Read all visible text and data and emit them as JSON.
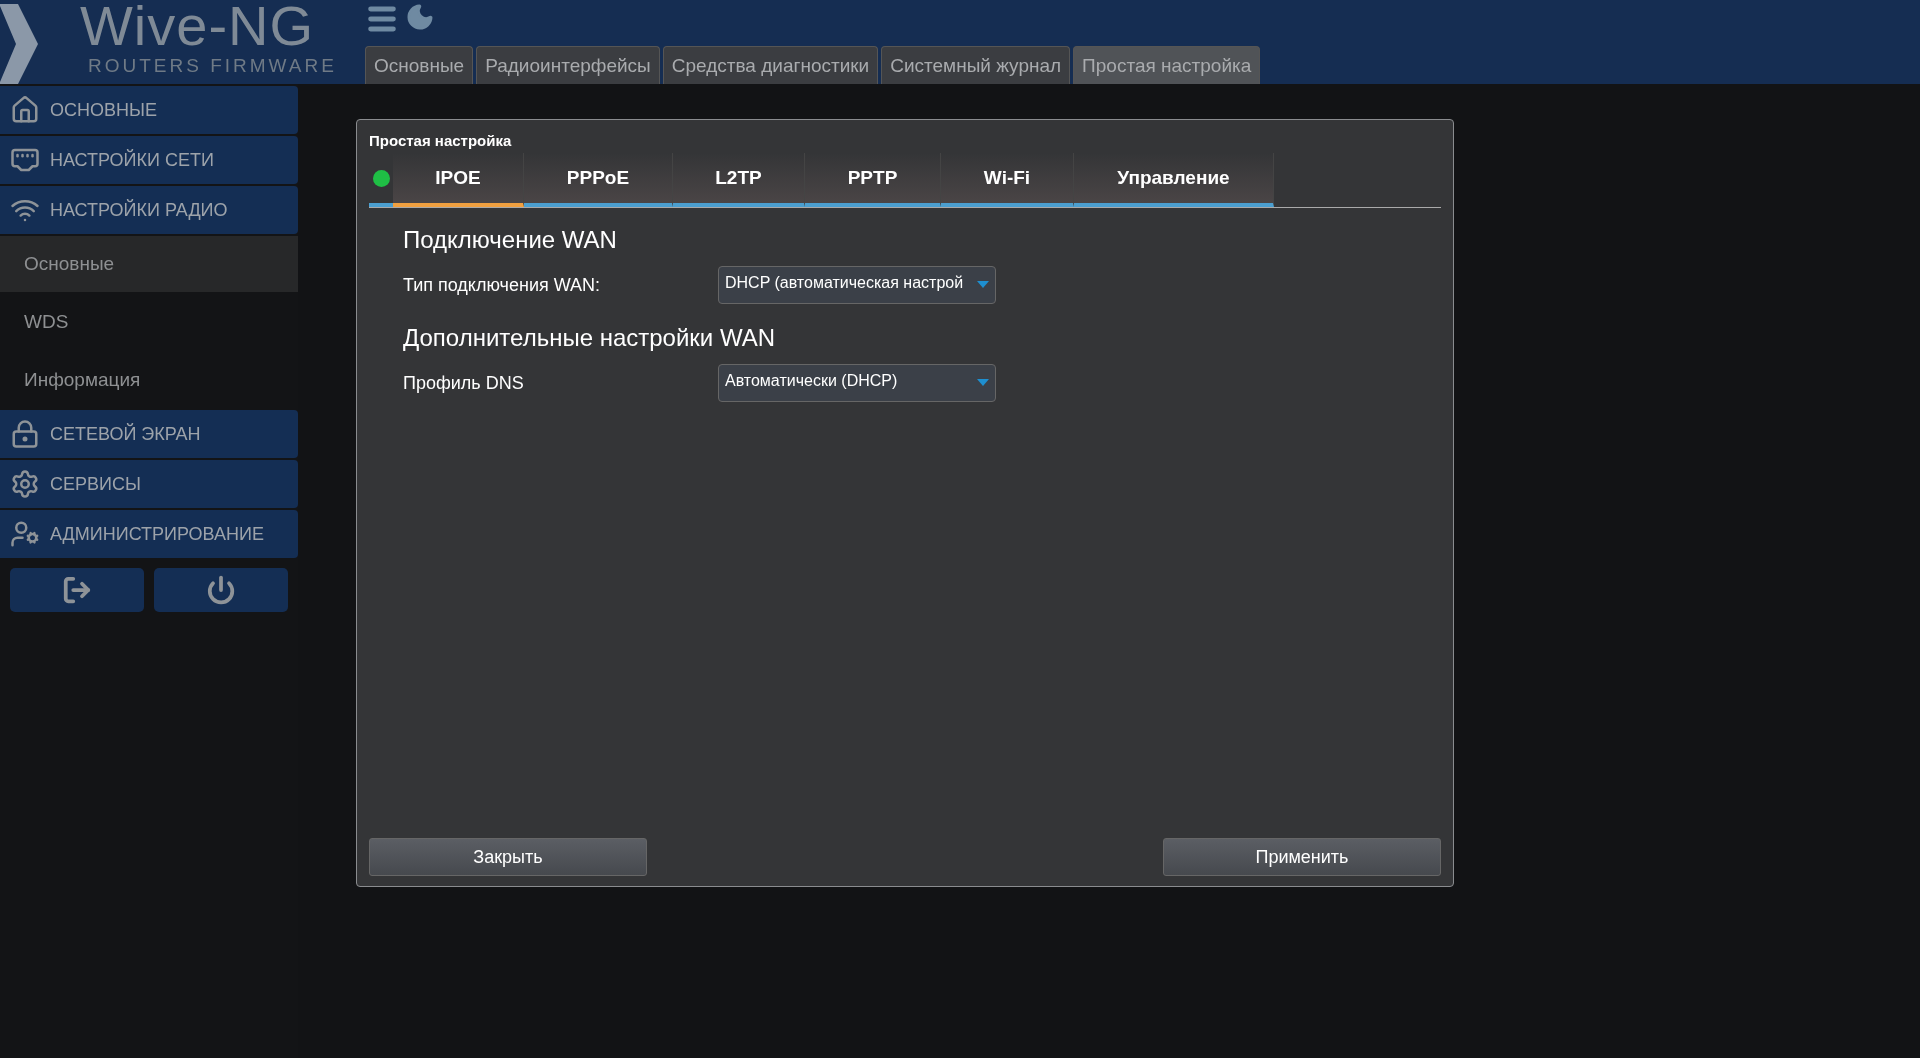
{
  "logo": {
    "title": "Wive-NG",
    "subtitle": "ROUTERS FIRMWARE"
  },
  "top_tabs": [
    {
      "label": "Основные",
      "selected": false
    },
    {
      "label": "Радиоинтерфейсы",
      "selected": false
    },
    {
      "label": "Средства диагностики",
      "selected": false
    },
    {
      "label": "Системный журнал",
      "selected": false
    },
    {
      "label": "Простая настройка",
      "selected": true
    }
  ],
  "sidebar": {
    "items": [
      {
        "label": "ОСНОВНЫЕ"
      },
      {
        "label": "НАСТРОЙКИ СЕТИ"
      },
      {
        "label": "НАСТРОЙКИ РАДИО",
        "children": [
          {
            "label": "Основные",
            "selected": true
          },
          {
            "label": "WDS",
            "selected": false
          },
          {
            "label": "Информация",
            "selected": false
          }
        ]
      },
      {
        "label": "СЕТЕВОЙ ЭКРАН"
      },
      {
        "label": "СЕРВИСЫ"
      },
      {
        "label": "АДМИНИСТРИРОВАНИЕ"
      }
    ]
  },
  "dialog": {
    "title": "Простая настройка",
    "connected": true,
    "tabs": [
      {
        "label": "IPOE",
        "selected": true
      },
      {
        "label": "PPPoE",
        "selected": false
      },
      {
        "label": "L2TP",
        "selected": false
      },
      {
        "label": "PPTP",
        "selected": false
      },
      {
        "label": "Wi-Fi",
        "selected": false
      },
      {
        "label": "Управление",
        "selected": false
      }
    ],
    "sections": [
      {
        "heading": "Подключение WAN",
        "fields": [
          {
            "label": "Тип подключения WAN:",
            "value": "DHCP (автоматическая настрой"
          }
        ]
      },
      {
        "heading": "Дополнительные настройки WAN",
        "fields": [
          {
            "label": "Профиль DNS",
            "value": "Автоматически (DHCP)"
          }
        ]
      }
    ],
    "buttons": [
      "Закрыть",
      "Применить"
    ]
  }
}
